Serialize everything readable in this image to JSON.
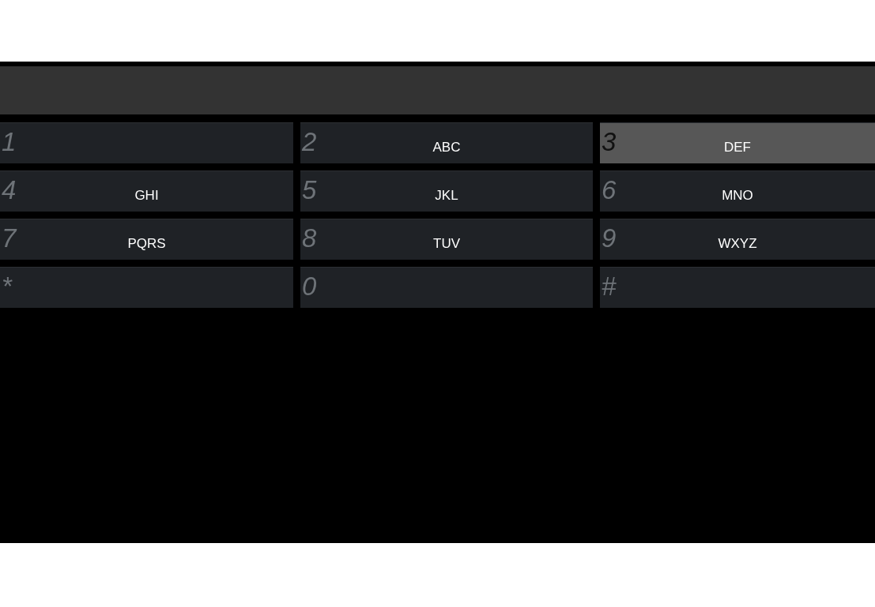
{
  "keys": [
    {
      "digit": "1",
      "selected": false
    },
    {
      "digit": "2",
      "letters": "ABC",
      "selected": false
    },
    {
      "digit": "3",
      "letters": "DEF",
      "selected": true
    },
    {
      "digit": "4",
      "letters": "GHI",
      "selected": false
    },
    {
      "digit": "5",
      "letters": "JKL",
      "selected": false
    },
    {
      "digit": "6",
      "letters": "MNO",
      "selected": false
    },
    {
      "digit": "7",
      "letters": "PQRS",
      "selected": false
    },
    {
      "digit": "8",
      "letters": "TUV",
      "selected": false
    },
    {
      "digit": "9",
      "letters": "WXYZ",
      "selected": false
    },
    {
      "digit": "*",
      "selected": false
    },
    {
      "digit": "0",
      "selected": false
    },
    {
      "digit": "#",
      "selected": false
    }
  ]
}
